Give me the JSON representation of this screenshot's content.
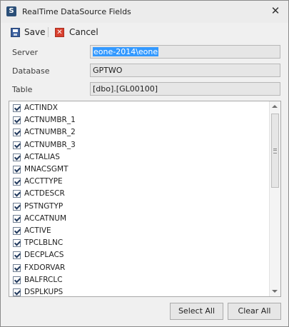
{
  "window": {
    "title": "RealTime DataSource Fields",
    "close_glyph": "✕"
  },
  "toolbar": {
    "save_label": "Save",
    "cancel_label": "Cancel"
  },
  "fields": {
    "server": {
      "label": "Server",
      "value": "eone-2014\\eone"
    },
    "database": {
      "label": "Database",
      "value": "GPTWO"
    },
    "table": {
      "label": "Table",
      "value": "[dbo].[GL00100]"
    }
  },
  "list": {
    "items": [
      {
        "label": "ACTINDX",
        "checked": true
      },
      {
        "label": "ACTNUMBR_1",
        "checked": true
      },
      {
        "label": "ACTNUMBR_2",
        "checked": true
      },
      {
        "label": "ACTNUMBR_3",
        "checked": true
      },
      {
        "label": "ACTALIAS",
        "checked": true
      },
      {
        "label": "MNACSGMT",
        "checked": true
      },
      {
        "label": "ACCTTYPE",
        "checked": true
      },
      {
        "label": "ACTDESCR",
        "checked": true
      },
      {
        "label": "PSTNGTYP",
        "checked": true
      },
      {
        "label": "ACCATNUM",
        "checked": true
      },
      {
        "label": "ACTIVE",
        "checked": true
      },
      {
        "label": "TPCLBLNC",
        "checked": true
      },
      {
        "label": "DECPLACS",
        "checked": true
      },
      {
        "label": "FXDORVAR",
        "checked": true
      },
      {
        "label": "BALFRCLC",
        "checked": true
      },
      {
        "label": "DSPLKUPS",
        "checked": true
      }
    ]
  },
  "buttons": {
    "select_all": "Select All",
    "clear_all": "Clear All"
  },
  "icons": {
    "app": "app-logo-icon",
    "save": "floppy-disk-icon",
    "cancel": "red-x-icon"
  }
}
